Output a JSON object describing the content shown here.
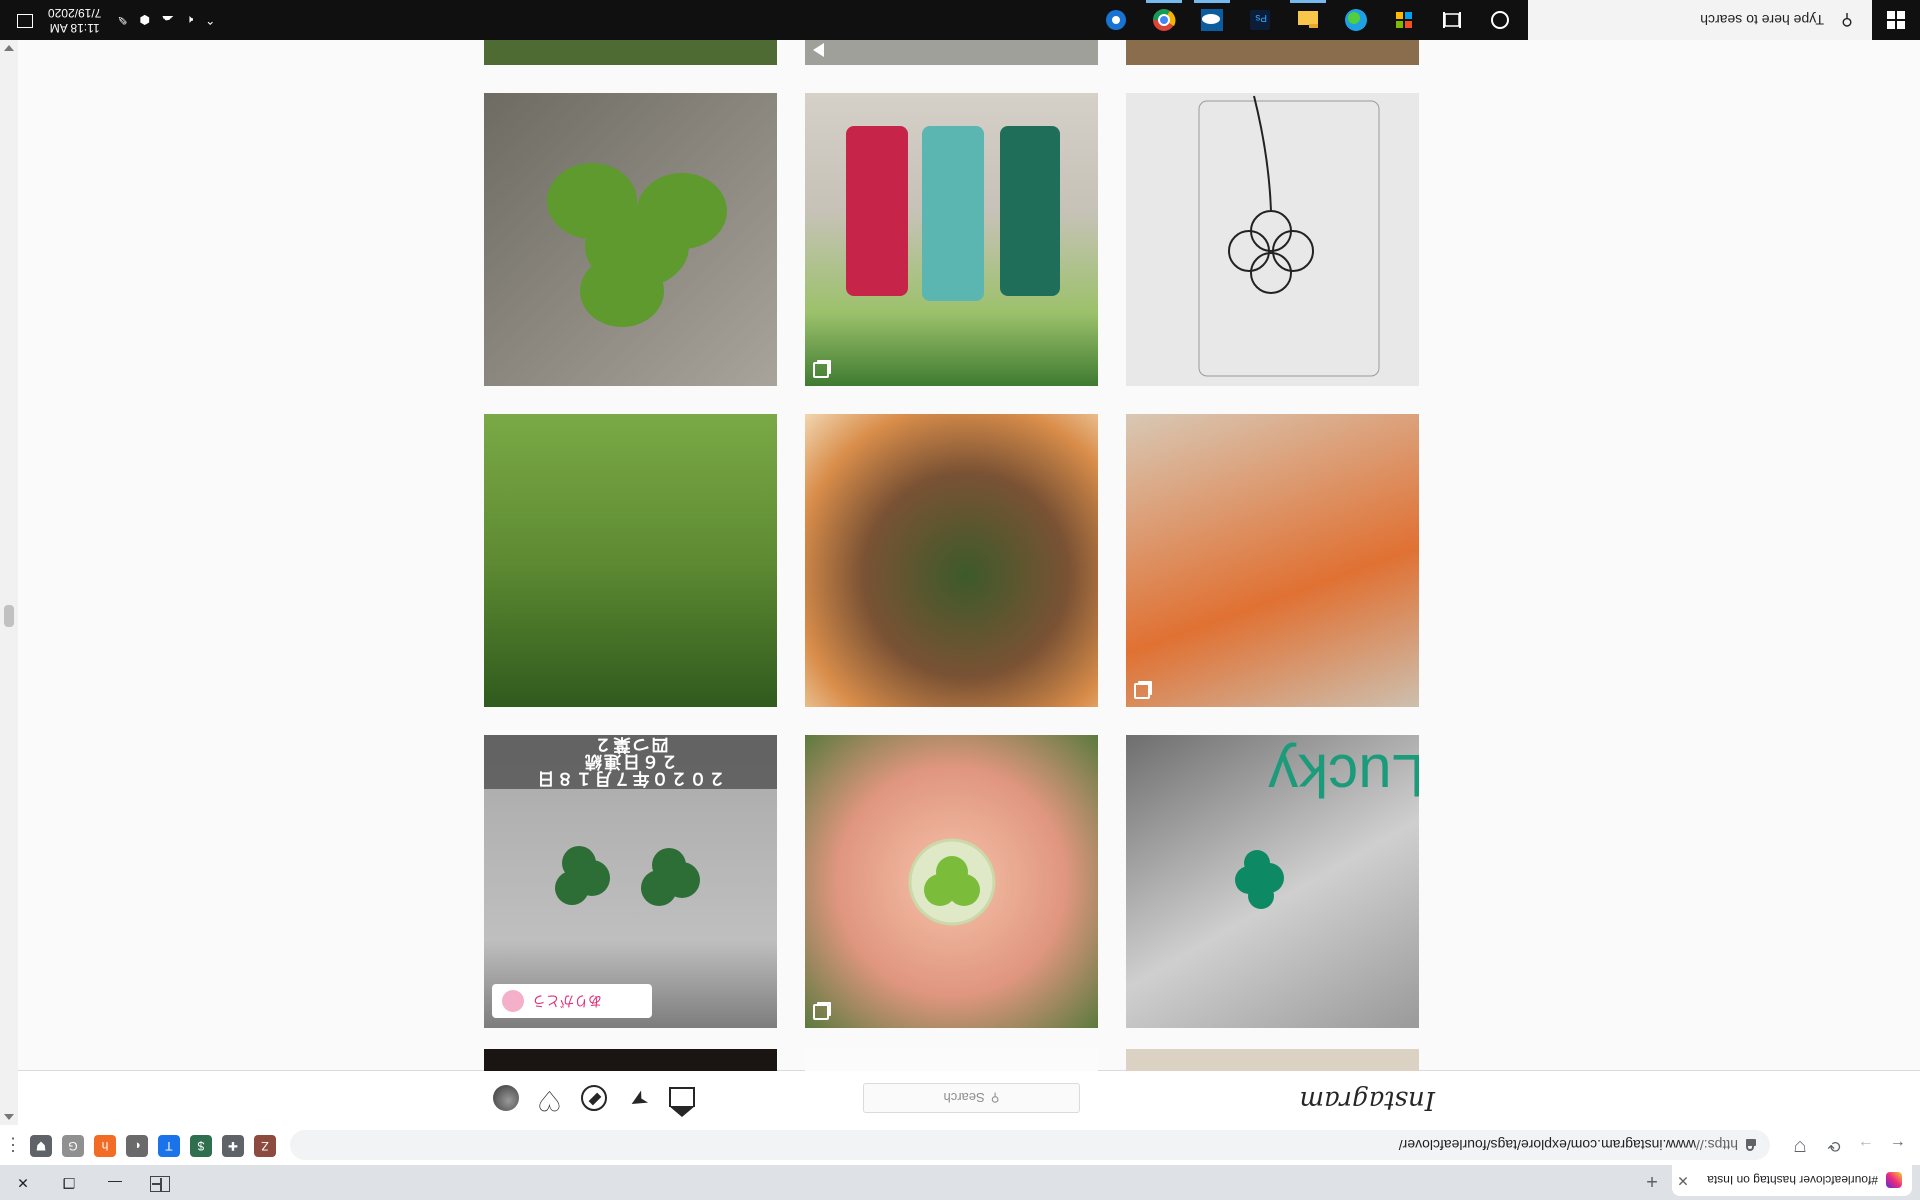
{
  "browser": {
    "tab_title": "#fourleafclover hashtag on Insta",
    "tab_close": "✕",
    "new_tab": "+",
    "url_prefix": "https://",
    "url_main": "www.instagram.com/explore/tags/fourleafclover/",
    "back": "←",
    "forward": "→",
    "reload": "⟳",
    "menu": "⋮",
    "window_min": "—",
    "window_restore": "❐",
    "window_close": "✕",
    "extensions": [
      {
        "icon": "bookmark-icon",
        "glyph": "⛊",
        "color": "#5f6368"
      },
      {
        "icon": "grammarly-icon",
        "glyph": "G",
        "color": "#909090"
      },
      {
        "icon": "honey-icon",
        "glyph": "h",
        "color": "#f26c25"
      },
      {
        "icon": "dark-reader-icon",
        "glyph": "◐",
        "color": "#6a6a6a"
      },
      {
        "icon": "translate-icon",
        "glyph": "T",
        "color": "#1a73e8"
      },
      {
        "icon": "money-icon",
        "glyph": "$",
        "color": "#2f6f4f"
      },
      {
        "icon": "puzzle-icon",
        "glyph": "✚",
        "color": "#5f6368"
      },
      {
        "icon": "profile-avatar-icon",
        "glyph": "Z",
        "color": "#8d4b3f"
      }
    ]
  },
  "instagram": {
    "logo": "Instagram",
    "search_placeholder": "Search",
    "nav_icons": [
      "home-icon",
      "direct-message-icon",
      "explore-icon",
      "activity-heart-icon",
      "profile-avatar-icon"
    ],
    "tile_texts": {
      "caption_line1": "２０２０年７月１８日",
      "caption_line2": "２６日連続",
      "caption_line3": "四つ葉２",
      "badge": "ありがとう",
      "lucky": "Lucky"
    }
  },
  "taskbar": {
    "search_placeholder": "Type here to search",
    "apps": [
      "cortana-icon",
      "task-view-icon",
      "microsoft-store-icon",
      "edge-icon",
      "file-explorer-icon",
      "photoshop-icon",
      "onedrive-icon",
      "chrome-icon",
      "settings-icon"
    ],
    "time": "11:18 AM",
    "date": "7/19/2020"
  },
  "colors": {
    "instagram_gradient": [
      "#f9ce34",
      "#ee2a7b",
      "#6228d7"
    ],
    "taskbar_bg": "#101010",
    "active_app_underline": "#76b9ed"
  }
}
